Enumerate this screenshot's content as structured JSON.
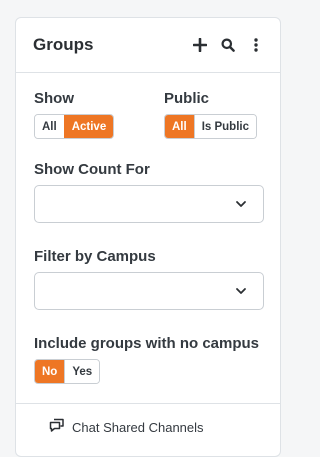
{
  "panel": {
    "title": "Groups",
    "header_icons": [
      "plus-icon",
      "search-icon",
      "more-vertical-icon"
    ]
  },
  "filters": {
    "show": {
      "label": "Show",
      "options": [
        "All",
        "Active"
      ],
      "selected": "Active"
    },
    "public": {
      "label": "Public",
      "options": [
        "All",
        "Is Public"
      ],
      "selected": "All"
    },
    "show_count_for": {
      "label": "Show Count For",
      "value": ""
    },
    "filter_by_campus": {
      "label": "Filter by Campus",
      "value": ""
    },
    "include_no_campus": {
      "label": "Include groups with no campus",
      "options": [
        "No",
        "Yes"
      ],
      "selected": "No"
    }
  },
  "footer": {
    "link_label": "Chat Shared Channels",
    "icon": "chat-icon"
  },
  "colors": {
    "accent": "#ee7624",
    "border": "#dee2e6",
    "text": "#343a40"
  }
}
